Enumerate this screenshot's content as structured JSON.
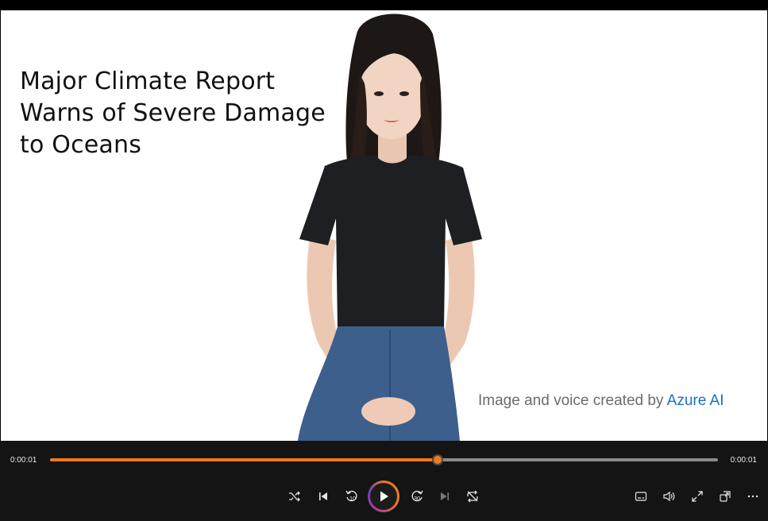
{
  "video": {
    "headline_lines": [
      "Major Climate Report",
      "Warns of Severe Damage",
      "to Oceans"
    ],
    "credit_text": "Image and voice created by",
    "credit_brand": "Azure AI"
  },
  "player": {
    "elapsed": "0:00:01",
    "duration": "0:00:01",
    "progress_fraction": 0.58,
    "accent_color": "#f07a1c",
    "controls": [
      {
        "name": "shuffle-button",
        "icon": "shuffle-icon"
      },
      {
        "name": "previous-button",
        "icon": "skip-previous-icon"
      },
      {
        "name": "rewind-10-button",
        "icon": "rewind-10-icon",
        "label": "10"
      },
      {
        "name": "play-button",
        "icon": "play-icon"
      },
      {
        "name": "forward-30-button",
        "icon": "forward-30-icon",
        "label": "30"
      },
      {
        "name": "next-button",
        "icon": "skip-next-icon"
      },
      {
        "name": "repeat-button",
        "icon": "repeat-icon"
      },
      {
        "name": "captions-button",
        "icon": "captions-icon"
      },
      {
        "name": "volume-button",
        "icon": "volume-icon"
      },
      {
        "name": "fullscreen-button",
        "icon": "fullscreen-icon"
      },
      {
        "name": "mini-player-button",
        "icon": "mini-player-icon"
      },
      {
        "name": "more-options-button",
        "icon": "more-icon"
      }
    ]
  }
}
